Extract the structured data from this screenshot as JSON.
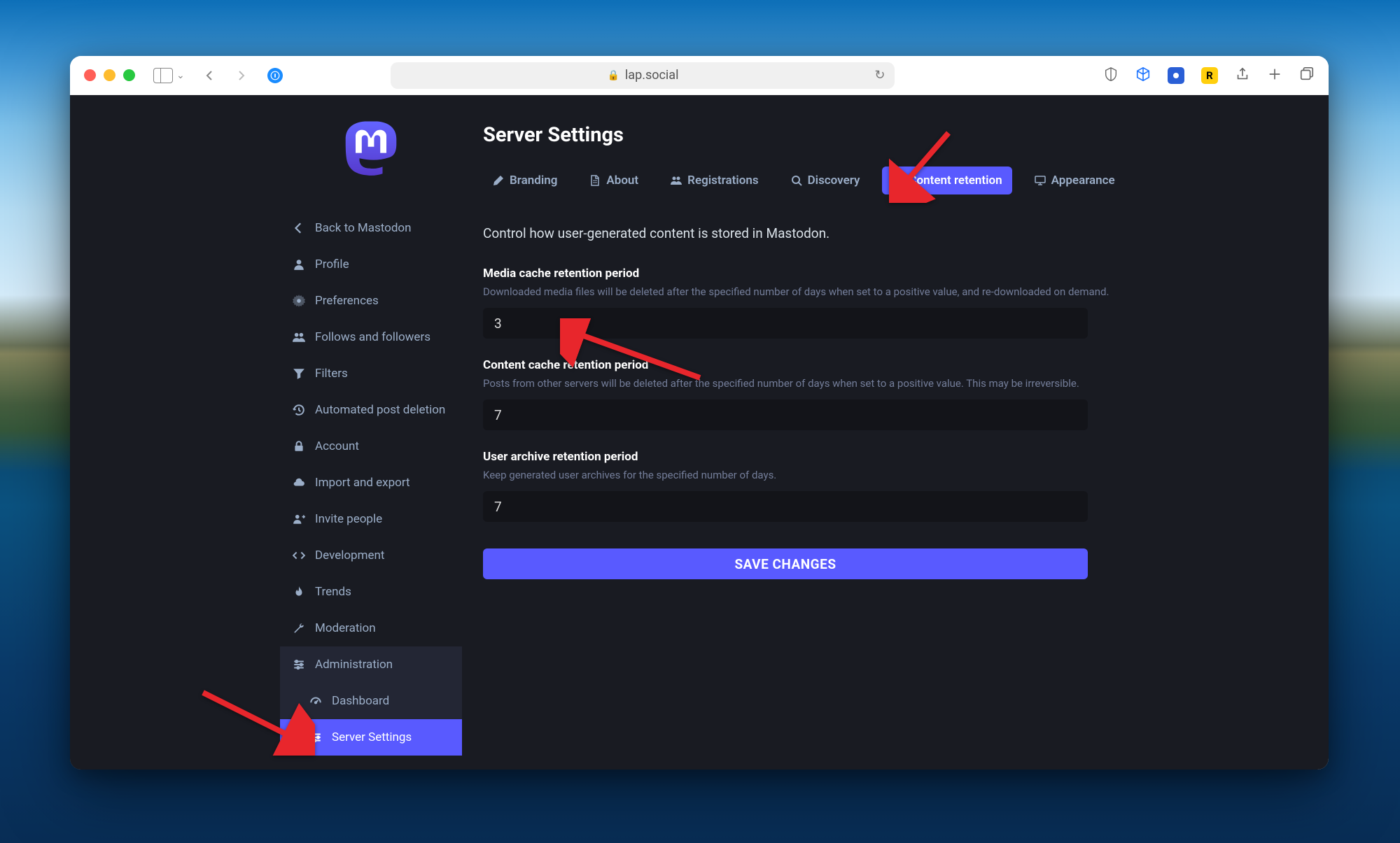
{
  "browser": {
    "url": "lap.social"
  },
  "sidebar": {
    "back": "Back to Mastodon",
    "items": [
      {
        "label": "Profile",
        "icon": "user"
      },
      {
        "label": "Preferences",
        "icon": "gear"
      },
      {
        "label": "Follows and followers",
        "icon": "users"
      },
      {
        "label": "Filters",
        "icon": "filter"
      },
      {
        "label": "Automated post deletion",
        "icon": "history"
      },
      {
        "label": "Account",
        "icon": "lock"
      },
      {
        "label": "Import and export",
        "icon": "cloud"
      },
      {
        "label": "Invite people",
        "icon": "user-plus"
      },
      {
        "label": "Development",
        "icon": "code"
      },
      {
        "label": "Trends",
        "icon": "fire"
      },
      {
        "label": "Moderation",
        "icon": "wrench"
      },
      {
        "label": "Administration",
        "icon": "sliders",
        "parent_active": true
      },
      {
        "label": "Dashboard",
        "icon": "dashboard",
        "sub": true
      },
      {
        "label": "Server Settings",
        "icon": "sliders",
        "sub": true,
        "active": true
      }
    ]
  },
  "page": {
    "title": "Server Settings",
    "intro": "Control how user-generated content is stored in Mastodon."
  },
  "tabs": [
    {
      "label": "Branding",
      "icon": "pencil"
    },
    {
      "label": "About",
      "icon": "file"
    },
    {
      "label": "Registrations",
      "icon": "users"
    },
    {
      "label": "Discovery",
      "icon": "search"
    },
    {
      "label": "Content retention",
      "icon": "history",
      "active": true
    },
    {
      "label": "Appearance",
      "icon": "monitor"
    }
  ],
  "fields": {
    "media": {
      "label": "Media cache retention period",
      "hint": "Downloaded media files will be deleted after the specified number of days when set to a positive value, and re-downloaded on demand.",
      "value": "3"
    },
    "content": {
      "label": "Content cache retention period",
      "hint": "Posts from other servers will be deleted after the specified number of days when set to a positive value. This may be irreversible.",
      "value": "7"
    },
    "archive": {
      "label": "User archive retention period",
      "hint": "Keep generated user archives for the specified number of days.",
      "value": "7"
    }
  },
  "save_button": "SAVE CHANGES"
}
